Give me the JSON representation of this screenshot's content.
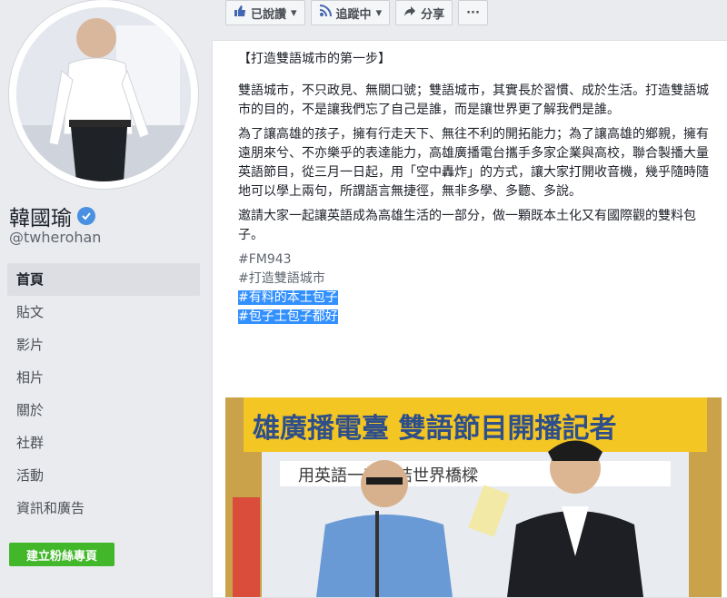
{
  "topbar": {
    "liked_label": "已說讚",
    "following_label": "追蹤中",
    "share_label": "分享",
    "more_label": "···"
  },
  "profile": {
    "name": "韓國瑜",
    "handle": "@twherohan"
  },
  "nav": {
    "items": [
      {
        "label": "首頁"
      },
      {
        "label": "貼文"
      },
      {
        "label": "影片"
      },
      {
        "label": "相片"
      },
      {
        "label": "關於"
      },
      {
        "label": "社群"
      },
      {
        "label": "活動"
      },
      {
        "label": "資訊和廣告"
      }
    ]
  },
  "create_page_label": "建立粉絲專頁",
  "post": {
    "title": "【打造雙語城市的第一步】",
    "paragraphs": [
      "雙語城市，不只政見、無關口號；雙語城市，其實長於習慣、成於生活。打造雙語城市的目的，不是讓我們忘了自己是誰，而是讓世界更了解我們是誰。",
      "為了讓高雄的孩子，擁有行走天下、無往不利的開拓能力；為了讓高雄的鄉親，擁有遠朋來兮、不亦樂乎的表達能力，高雄廣播電台攜手多家企業與高校，聯合製播大量英語節目，從三月一日起，用「空中轟炸」的方式，讓大家打開收音機，幾乎隨時隨地可以學上兩句，所謂語言無捷徑，無非多學、多聽、多說。",
      "邀請大家一起讓英語成為高雄生活的一部分，做一顆既本土化又有國際觀的雙料包子。"
    ],
    "hashtags": [
      "#FM943",
      "#打造雙語城市",
      "#有料的本土包子",
      "#包子土包子都好"
    ]
  },
  "photo": {
    "banner_text": "雄廣播電臺  雙語節目開播記者",
    "banner_sub": "用英語一起連結世界橋樑"
  },
  "colors": {
    "page_bg": "#e9ebee",
    "create_button": "#42b72a",
    "verified_badge": "#4a90e2",
    "selection": "#3390ff"
  }
}
